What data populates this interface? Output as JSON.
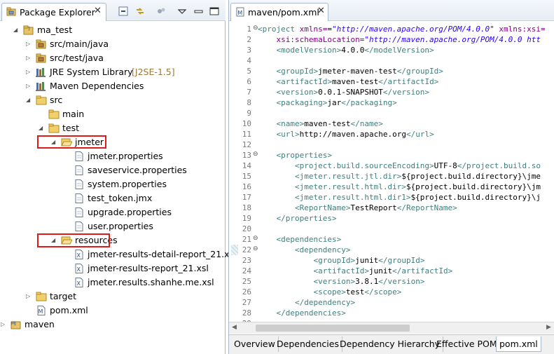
{
  "explorer": {
    "title": "Package Explorer",
    "close": "✕",
    "tree": [
      {
        "label": "ma_test",
        "icon": "project-icon",
        "arrow": "◢"
      },
      {
        "label": "src/main/java",
        "icon": "package-folder-icon",
        "arrow": "▷"
      },
      {
        "label": "src/test/java",
        "icon": "package-folder-icon",
        "arrow": "▷"
      },
      {
        "label": "JRE System Library",
        "decoration": "[J2SE-1.5]",
        "icon": "library-icon",
        "arrow": "▷"
      },
      {
        "label": "Maven Dependencies",
        "icon": "library-icon",
        "arrow": "▷"
      },
      {
        "label": "src",
        "icon": "folder-icon",
        "arrow": "◢"
      },
      {
        "label": "main",
        "icon": "folder-icon",
        "arrow": ""
      },
      {
        "label": "test",
        "icon": "folder-icon",
        "arrow": "◢"
      },
      {
        "label": "jmeter",
        "icon": "folder-open-icon",
        "arrow": "◢"
      },
      {
        "label": "jmeter.properties",
        "icon": "file-icon",
        "arrow": ""
      },
      {
        "label": "saveservice.properties",
        "icon": "file-icon",
        "arrow": ""
      },
      {
        "label": "system.properties",
        "icon": "file-icon",
        "arrow": ""
      },
      {
        "label": "test_token.jmx",
        "icon": "file-icon",
        "arrow": ""
      },
      {
        "label": "upgrade.properties",
        "icon": "file-icon",
        "arrow": ""
      },
      {
        "label": "user.properties",
        "icon": "file-icon",
        "arrow": ""
      },
      {
        "label": "resources",
        "icon": "folder-open-icon",
        "arrow": "◢"
      },
      {
        "label": "jmeter-results-detail-report_21.xsl",
        "icon": "xsl-file-icon",
        "arrow": ""
      },
      {
        "label": "jmeter-results-report_21.xsl",
        "icon": "xsl-file-icon",
        "arrow": ""
      },
      {
        "label": "jmeter.results.shanhe.me.xsl",
        "icon": "xsl-file-icon",
        "arrow": ""
      },
      {
        "label": "target",
        "icon": "folder-icon",
        "arrow": "▷"
      },
      {
        "label": "pom.xml",
        "icon": "maven-file-icon",
        "arrow": ""
      },
      {
        "label": "maven",
        "icon": "maven-project-icon",
        "arrow": "▷"
      }
    ]
  },
  "editor": {
    "tab_title": "maven/pom.xml",
    "close": "✕",
    "bottom_tabs": [
      "Overview",
      "Dependencies",
      "Dependency Hierarchy",
      "Effective POM",
      "pom.xml"
    ],
    "active_bottom_tab": "pom.xml",
    "lines": [
      "1",
      "2",
      "3",
      "4",
      "5",
      "6",
      "7",
      "8",
      "9",
      "10",
      "11",
      "12",
      "13",
      "14",
      "15",
      "16",
      "17",
      "18",
      "19",
      "20",
      "21",
      "22",
      "23",
      "24",
      "25",
      "26",
      "27",
      "28",
      "29"
    ],
    "fold_markers": {
      "1": "⊖",
      "13": "⊖",
      "21": "⊖",
      "22": "⊖"
    },
    "code": {
      "l1_tag": "<project",
      "l1_attr1": " xmlns=",
      "l1_val1": "\"http://maven.apache.org/POM/4.0.0\"",
      "l1_attr2": " xmlns:xsi=",
      "l2_attr": "    xsi:schemaLocation=",
      "l2_val": "\"http://maven.apache.org/POM/4.0.0 htt",
      "l3_open": "<modelVersion>",
      "l3_text": "4.0.0",
      "l3_close": "</modelVersion>",
      "l5_open": "<groupId>",
      "l5_text": "jmeter-maven-test",
      "l5_close": "</groupId>",
      "l6_open": "<artifactId>",
      "l6_text": "maven-test",
      "l6_close": "</artifactId>",
      "l7_open": "<version>",
      "l7_text": "0.0.1-SNAPSHOT",
      "l7_close": "</version>",
      "l8_open": "<packaging>",
      "l8_text": "jar",
      "l8_close": "</packaging>",
      "l10_open": "<name>",
      "l10_text": "maven-test",
      "l10_close": "</name>",
      "l11_open": "<url>",
      "l11_text": "http://maven.apache.org",
      "l11_close": "</url>",
      "l13_open": "<properties>",
      "l14_open": "<project.build.sourceEncoding>",
      "l14_text": "UTF-8",
      "l14_close": "</project.build.so",
      "l15_open": "<jmeter.result.jtl.dir>",
      "l15_text": "${project.build.directory}\\jme",
      "l16_open": "<jmeter.result.html.dir>",
      "l16_text": "${project.build.directory}\\jm",
      "l17_open": "<jmeter.result.html.dir1>",
      "l17_text": "${project.build.directory}\\j",
      "l18_open": "<ReportName>",
      "l18_text": "TestReport",
      "l18_close": "</ReportName>",
      "l19_close": "</properties>",
      "l21_open": "<dependencies>",
      "l22_open": "<dependency>",
      "l23_open": "<groupId>",
      "l23_text": "junit",
      "l23_close": "</groupId>",
      "l24_open": "<artifactId>",
      "l24_text": "junit",
      "l24_close": "</artifactId>",
      "l25_open": "<version>",
      "l25_text": "3.8.1",
      "l25_close": "</version>",
      "l26_open": "<scope>",
      "l26_text": "test",
      "l26_close": "</scope>",
      "l27_close": "</dependency>",
      "l28_close": "</dependencies>"
    }
  },
  "colors": {
    "highlight_box": "#e01a1a",
    "tag": "#3f7f7f",
    "attribute": "#7f007f",
    "string": "#2a00ff"
  }
}
